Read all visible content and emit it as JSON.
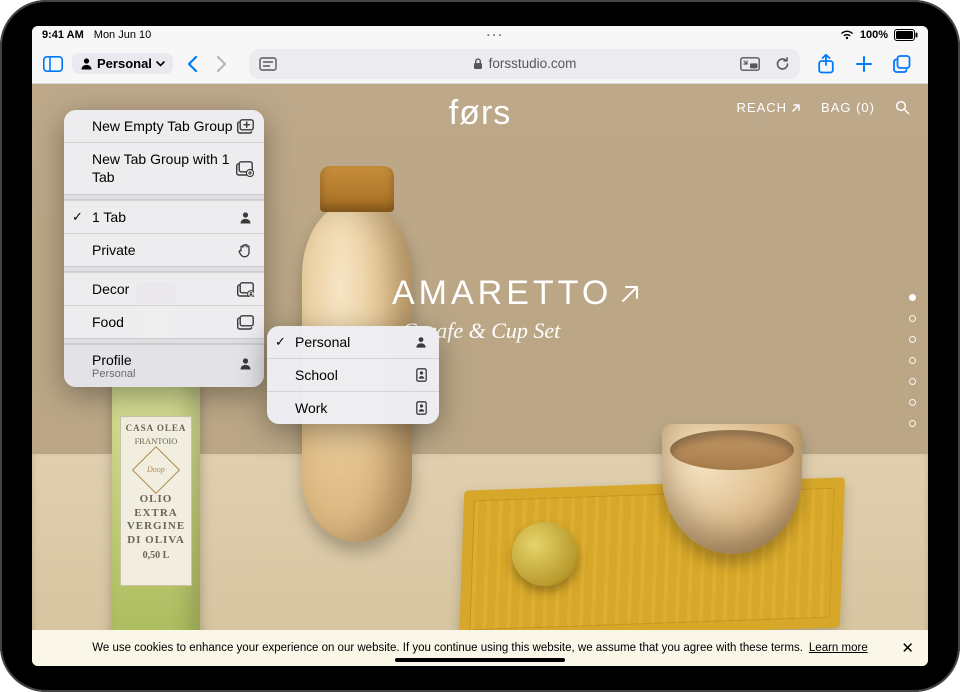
{
  "status": {
    "time": "9:41 AM",
    "date": "Mon Jun 10",
    "center_glyph": "···",
    "wifi_icon": "wifi",
    "battery_pct": "100%"
  },
  "toolbar": {
    "profile_label": "Personal",
    "url_display": "forsstudio.com"
  },
  "dropdown": {
    "new_empty": "New Empty Tab Group",
    "new_with": "New Tab Group with 1 Tab",
    "one_tab": "1 Tab",
    "private": "Private",
    "decor": "Decor",
    "food": "Food",
    "profile_label": "Profile",
    "profile_value": "Personal"
  },
  "submenu": {
    "personal": "Personal",
    "school": "School",
    "work": "Work"
  },
  "site": {
    "brand": "førs",
    "nav_reach": "REACH",
    "nav_bag": "BAG (0)",
    "hero_title": "AMARETTO",
    "hero_sub": "Carafe & Cup Set"
  },
  "bottle": {
    "brand": "CASA OLEA",
    "l1": "FRANTOIO",
    "stamp": "Doop",
    "big1": "OLIO EXTRA",
    "big2": "VERGINE",
    "big3": "DI OLIVA",
    "vol": "0,50 L"
  },
  "cookie": {
    "text": "We use cookies to enhance your experience on our website. If you continue using this website, we assume that you agree with these terms.",
    "learn": "Learn more"
  }
}
